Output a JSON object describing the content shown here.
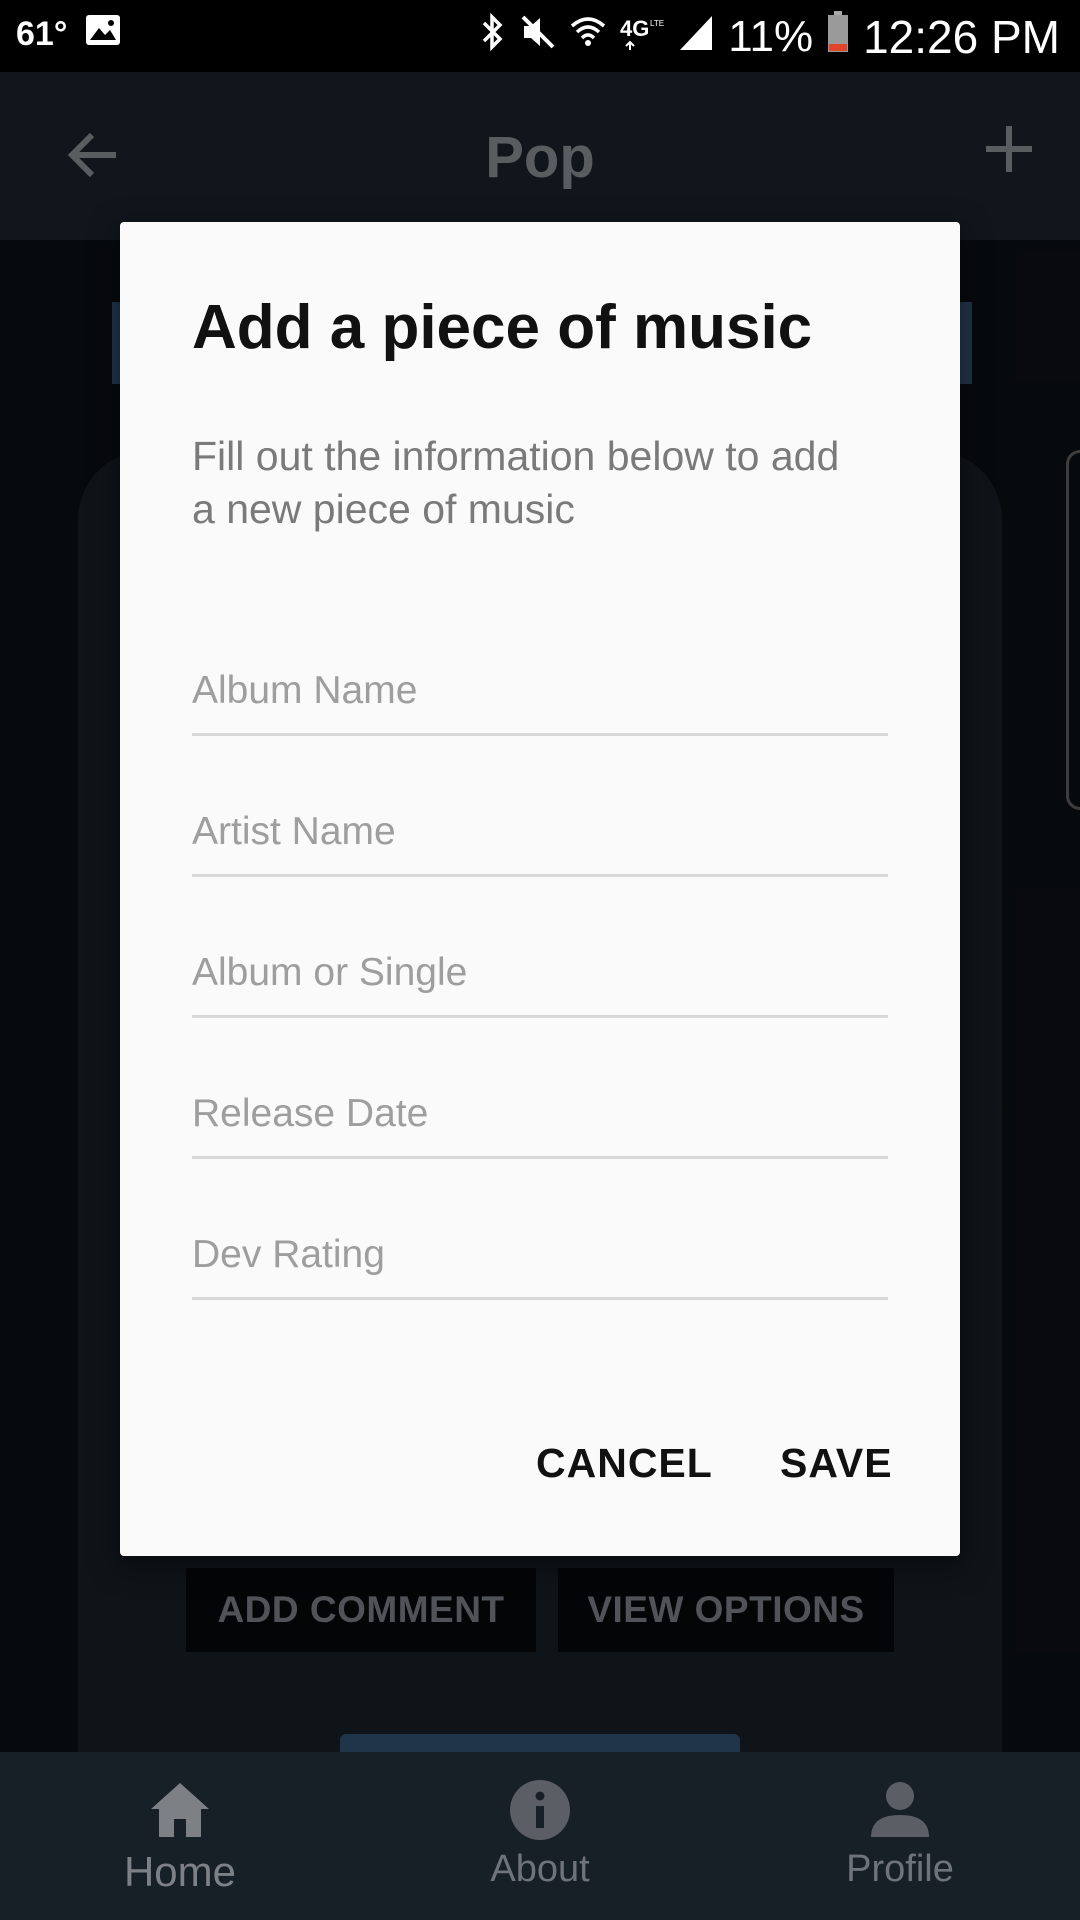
{
  "status_bar": {
    "temperature": "61°",
    "battery_percent": "11%",
    "time": "12:26 PM",
    "icons": [
      "image-icon",
      "bluetooth-icon",
      "mute-icon",
      "wifi-icon",
      "4g-lte-icon",
      "signal-icon",
      "battery-icon"
    ]
  },
  "app_bar": {
    "title": "Pop",
    "back_icon": "arrow-left-icon",
    "add_icon": "plus-icon"
  },
  "background": {
    "add_comment_label": "ADD COMMENT",
    "view_options_label": "VIEW OPTIONS"
  },
  "dialog": {
    "title": "Add a piece of music",
    "message": "Fill out the information below to add a new piece of music",
    "fields": [
      {
        "placeholder": "Album Name",
        "value": ""
      },
      {
        "placeholder": "Artist Name",
        "value": ""
      },
      {
        "placeholder": "Album or Single",
        "value": ""
      },
      {
        "placeholder": "Release Date",
        "value": ""
      },
      {
        "placeholder": "Dev Rating",
        "value": ""
      }
    ],
    "cancel_label": "CANCEL",
    "save_label": "SAVE"
  },
  "bottom_nav": {
    "items": [
      {
        "label": "Home",
        "icon": "home-icon",
        "active": true
      },
      {
        "label": "About",
        "icon": "info-icon",
        "active": false
      },
      {
        "label": "Profile",
        "icon": "person-icon",
        "active": false
      }
    ]
  },
  "colors": {
    "app_bar_bg": "#171f27",
    "dialog_bg": "#fafafa",
    "accent_banner": "#2b4a66"
  }
}
